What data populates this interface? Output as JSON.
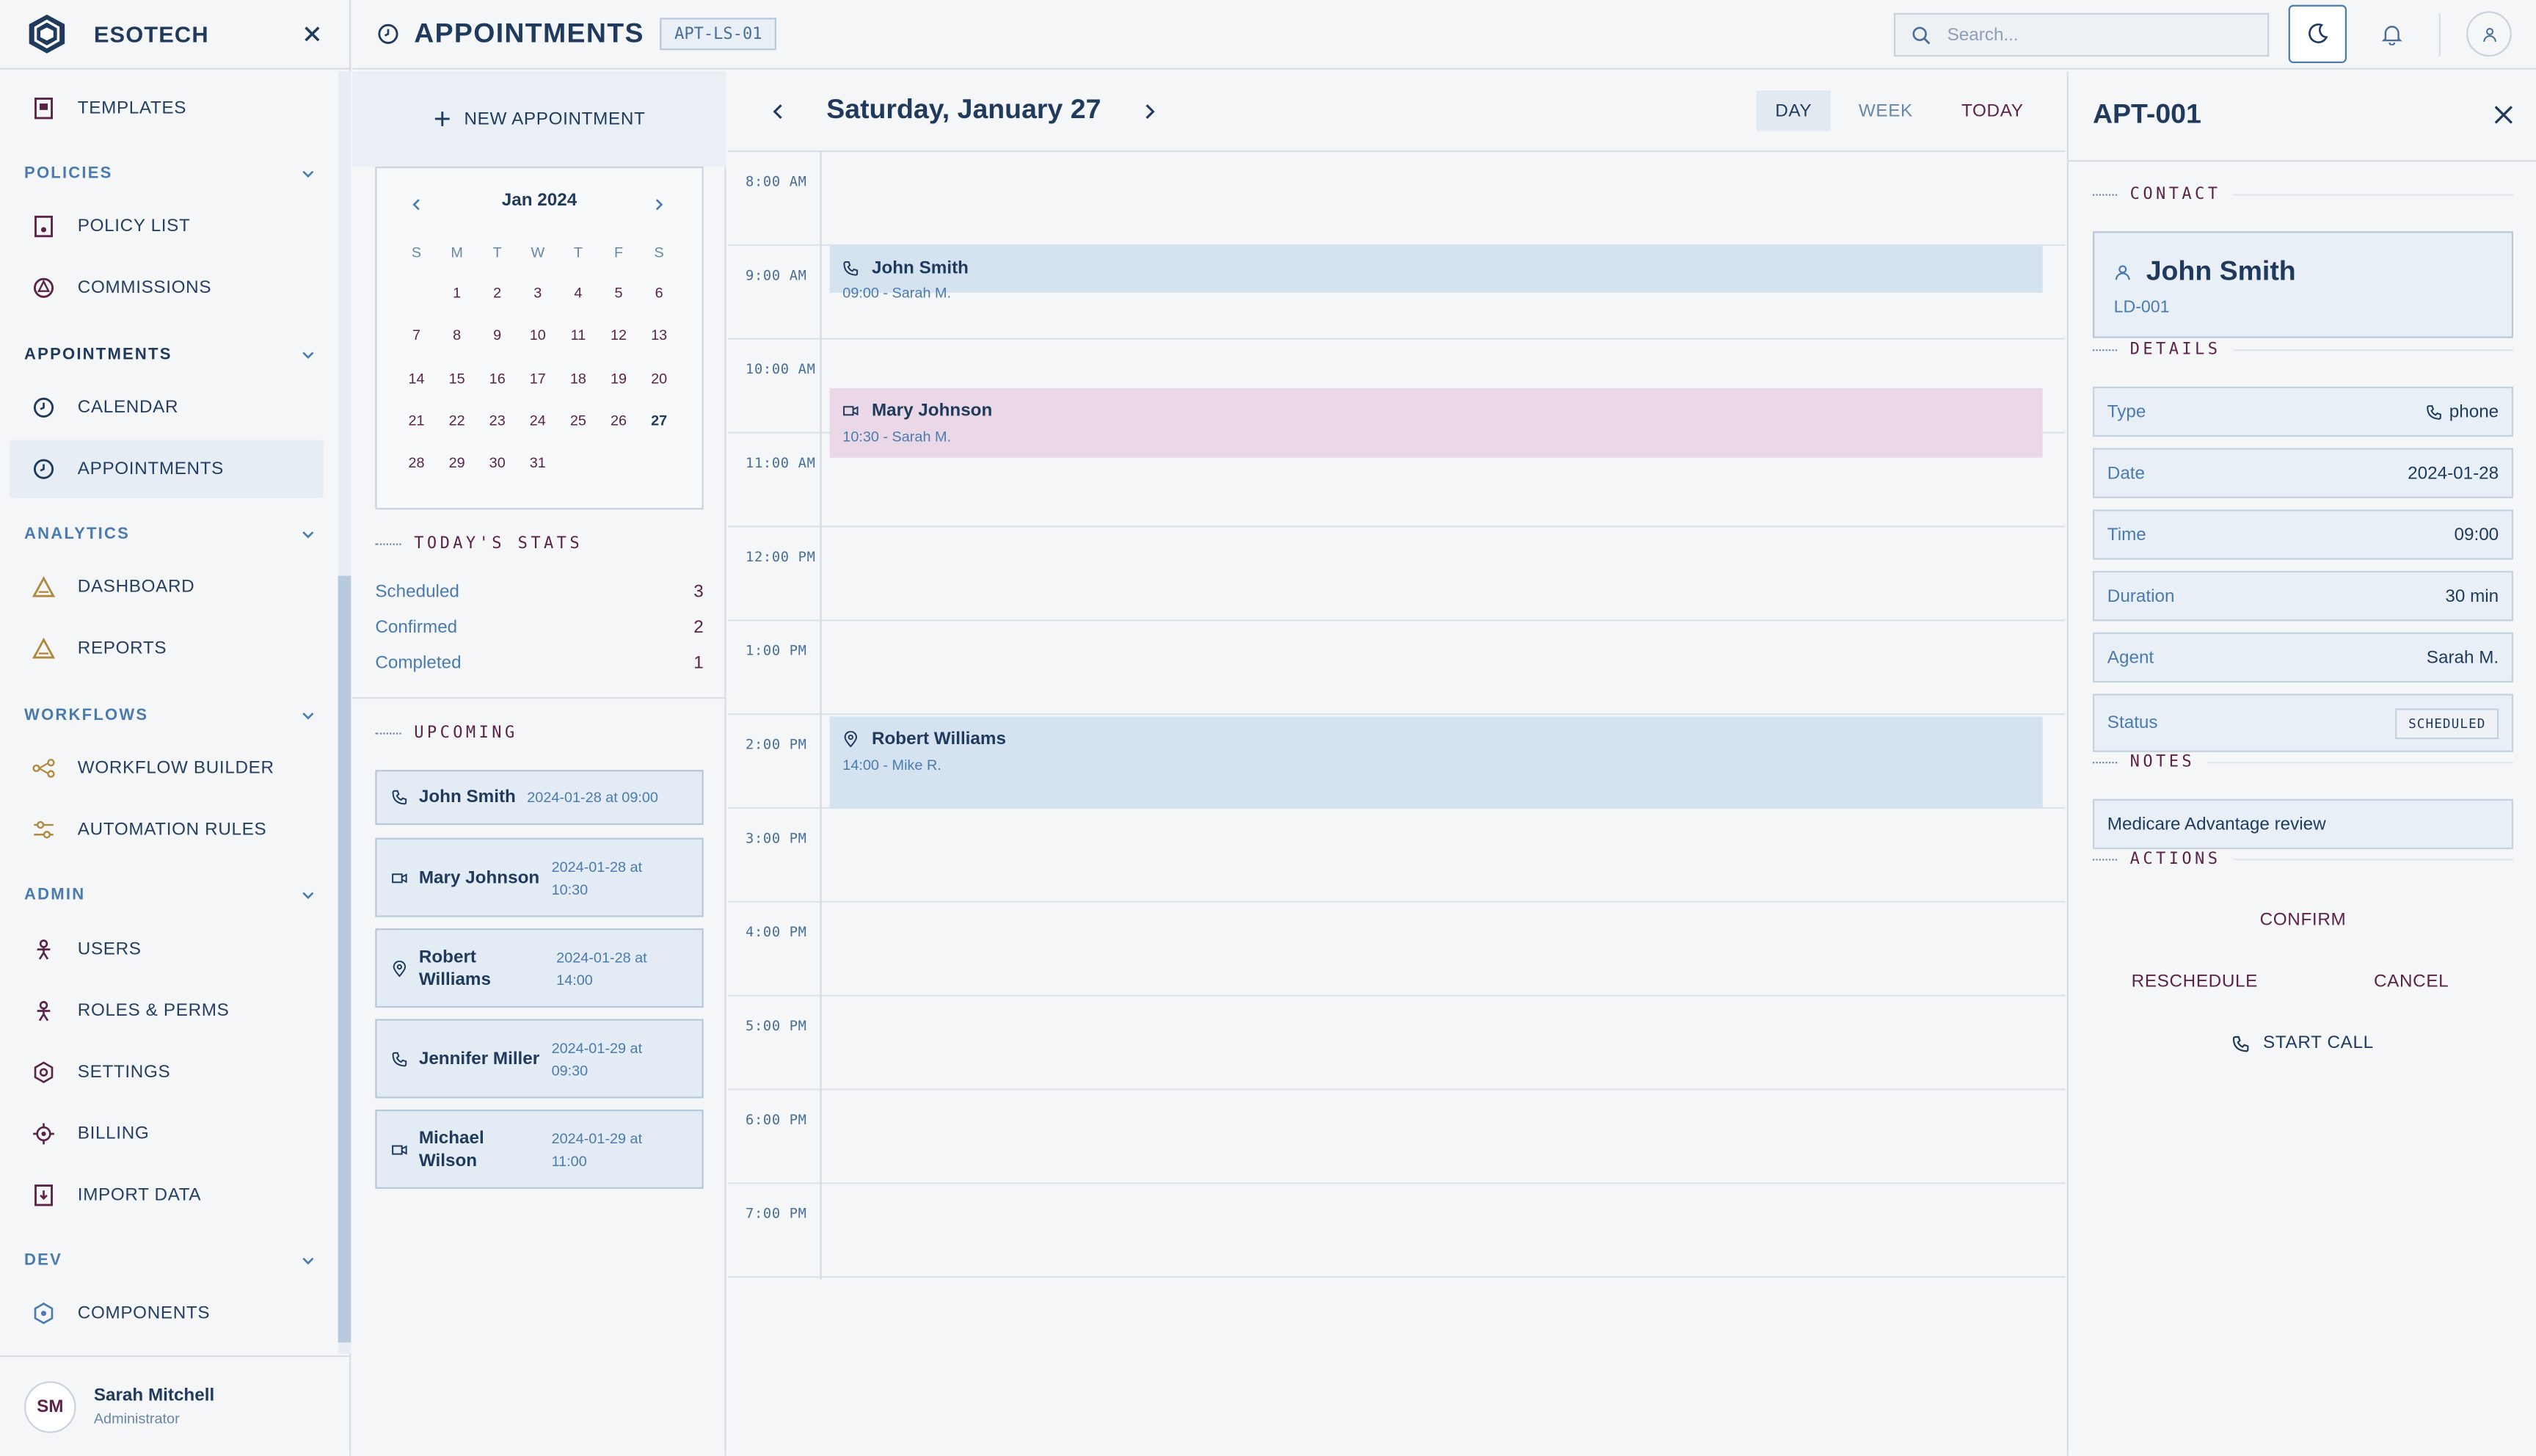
{
  "brand": {
    "name": "ESOTECH"
  },
  "sidebar": {
    "items": [
      {
        "label": "TEMPLATES"
      },
      {
        "group": "POLICIES"
      },
      {
        "label": "POLICY LIST"
      },
      {
        "label": "COMMISSIONS"
      },
      {
        "group": "APPOINTMENTS"
      },
      {
        "label": "CALENDAR"
      },
      {
        "label": "APPOINTMENTS"
      },
      {
        "group": "ANALYTICS"
      },
      {
        "label": "DASHBOARD"
      },
      {
        "label": "REPORTS"
      },
      {
        "group": "WORKFLOWS"
      },
      {
        "label": "WORKFLOW BUILDER"
      },
      {
        "label": "AUTOMATION RULES"
      },
      {
        "group": "ADMIN"
      },
      {
        "label": "USERS"
      },
      {
        "label": "ROLES & PERMS"
      },
      {
        "label": "SETTINGS"
      },
      {
        "label": "BILLING"
      },
      {
        "label": "IMPORT DATA"
      },
      {
        "group": "DEV"
      },
      {
        "label": "COMPONENTS"
      }
    ],
    "user": {
      "initials": "SM",
      "name": "Sarah Mitchell",
      "role": "Administrator"
    }
  },
  "header": {
    "title": "APPOINTMENTS",
    "badge": "APT-LS-01",
    "search_placeholder": "Search..."
  },
  "left_panel": {
    "new_label": "NEW APPOINTMENT",
    "minical": {
      "month": "Jan 2024",
      "dow": [
        "S",
        "M",
        "T",
        "W",
        "T",
        "F",
        "S"
      ],
      "weeks": [
        [
          "",
          "1",
          "2",
          "3",
          "4",
          "5",
          "6"
        ],
        [
          "7",
          "8",
          "9",
          "10",
          "11",
          "12",
          "13"
        ],
        [
          "14",
          "15",
          "16",
          "17",
          "18",
          "19",
          "20"
        ],
        [
          "21",
          "22",
          "23",
          "24",
          "25",
          "26",
          "27"
        ],
        [
          "28",
          "29",
          "30",
          "31",
          "",
          "",
          ""
        ]
      ],
      "selected": "27"
    },
    "stats_title": "TODAY'S STATS",
    "stats": [
      {
        "label": "Scheduled",
        "value": "3"
      },
      {
        "label": "Confirmed",
        "value": "2"
      },
      {
        "label": "Completed",
        "value": "1"
      }
    ],
    "upcoming_title": "UPCOMING",
    "upcoming": [
      {
        "name": "John Smith",
        "date": "2024-01-28 at 09:00",
        "icon": "phone-icon"
      },
      {
        "name": "Mary Johnson",
        "date": "2024-01-28 at 10:30",
        "icon": "video-icon"
      },
      {
        "name": "Robert Williams",
        "date": "2024-01-28 at 14:00",
        "icon": "location-pin-icon"
      },
      {
        "name": "Jennifer Miller",
        "date": "2024-01-29 at 09:30",
        "icon": "phone-icon"
      },
      {
        "name": "Michael Wilson",
        "date": "2024-01-29 at 11:00",
        "icon": "video-icon"
      }
    ]
  },
  "calendar": {
    "date_title": "Saturday, January 27",
    "views": {
      "day": "DAY",
      "week": "WEEK",
      "today": "TODAY"
    },
    "hours": [
      "8:00 AM",
      "9:00 AM",
      "10:00 AM",
      "11:00 AM",
      "12:00 PM",
      "1:00 PM",
      "2:00 PM",
      "3:00 PM",
      "4:00 PM",
      "5:00 PM",
      "6:00 PM",
      "7:00 PM"
    ],
    "events": [
      {
        "name": "John Smith",
        "sub": "09:00 - Sarah M.",
        "icon": "phone-icon"
      },
      {
        "name": "Mary Johnson",
        "sub": "10:30 - Sarah M.",
        "icon": "video-icon"
      },
      {
        "name": "Robert Williams",
        "sub": "14:00 - Mike R.",
        "icon": "location-pin-icon"
      }
    ]
  },
  "detail": {
    "id": "APT-001",
    "contact_title": "CONTACT",
    "contact_name": "John Smith",
    "contact_id": "LD-001",
    "details_title": "DETAILS",
    "fields": [
      {
        "label": "Type",
        "value": "phone"
      },
      {
        "label": "Date",
        "value": "2024-01-28"
      },
      {
        "label": "Time",
        "value": "09:00"
      },
      {
        "label": "Duration",
        "value": "30 min"
      },
      {
        "label": "Agent",
        "value": "Sarah M."
      },
      {
        "label": "Status",
        "value": "SCHEDULED"
      }
    ],
    "notes_title": "NOTES",
    "notes": "Medicare Advantage review",
    "actions_title": "ACTIONS",
    "actions": {
      "confirm": "CONFIRM",
      "reschedule": "RESCHEDULE",
      "cancel": "CANCEL",
      "start_call": "START CALL"
    }
  }
}
